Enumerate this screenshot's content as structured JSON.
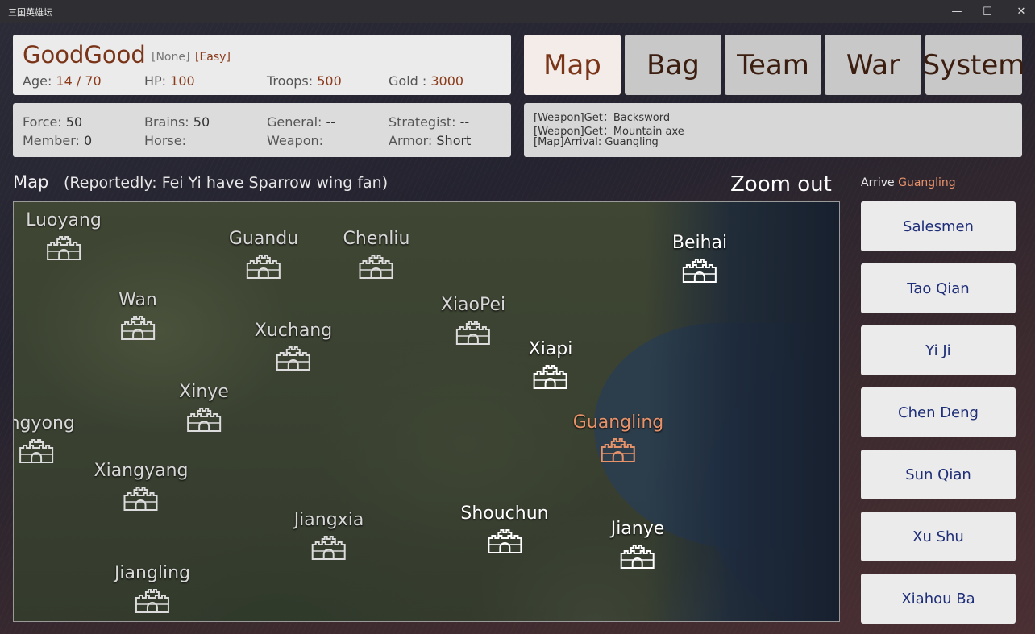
{
  "window": {
    "title": "三国英雄坛",
    "minimize": "—",
    "maximize": "☐",
    "close": "✕"
  },
  "player": {
    "name": "GoodGood",
    "faction": "[None]",
    "difficulty": "[Easy]",
    "age_label": "Age: ",
    "age_value": "14 / 70",
    "hp_label": "HP: ",
    "hp_value": "100",
    "troops_label": "Troops: ",
    "troops_value": "500",
    "gold_label": "Gold : ",
    "gold_value": "3000"
  },
  "stats": {
    "force_label": "Force: ",
    "force_value": "50",
    "brains_label": "Brains: ",
    "brains_value": "50",
    "general_label": "General: ",
    "general_value": "--",
    "strategist_label": "Strategist: ",
    "strategist_value": "--",
    "member_label": "Member: ",
    "member_value": "0",
    "horse_label": "Horse: ",
    "horse_value": "",
    "weapon_label": "Weapon: ",
    "weapon_value": "",
    "armor_label": "Armor: ",
    "armor_value": "Short"
  },
  "tabs": [
    {
      "label": "Map",
      "active": true
    },
    {
      "label": "Bag",
      "active": false
    },
    {
      "label": "Team",
      "active": false
    },
    {
      "label": "War",
      "active": false
    },
    {
      "label": "System",
      "active": false
    }
  ],
  "log": [
    "[Weapon]Get：Backsword",
    "[Weapon]Get：Mountain axe",
    "[Map]Arrival: Guangling"
  ],
  "map": {
    "heading": "Map",
    "rumor": "(Reportedly: Fei Yi have Sparrow wing fan)",
    "zoom_label": "Zoom out",
    "cities": [
      {
        "name": "Luoyang",
        "style": "normal"
      },
      {
        "name": "Guandu",
        "style": "normal"
      },
      {
        "name": "Chenliu",
        "style": "normal"
      },
      {
        "name": "Beihai",
        "style": "bright"
      },
      {
        "name": "Wan",
        "style": "normal"
      },
      {
        "name": "XiaoPei",
        "style": "normal"
      },
      {
        "name": "Xuchang",
        "style": "normal"
      },
      {
        "name": "Xiapi",
        "style": "bright"
      },
      {
        "name": "Xinye",
        "style": "normal"
      },
      {
        "name": "angyong",
        "style": "normal"
      },
      {
        "name": "Guangling",
        "style": "current"
      },
      {
        "name": "Xiangyang",
        "style": "normal"
      },
      {
        "name": "Shouchun",
        "style": "bright"
      },
      {
        "name": "Jiangxia",
        "style": "normal"
      },
      {
        "name": "Jianye",
        "style": "bright"
      },
      {
        "name": "Jiangling",
        "style": "normal"
      }
    ]
  },
  "location": {
    "arrive_label": "Arrive ",
    "place": "Guangling",
    "people": [
      "Salesmen",
      "Tao Qian",
      "Yi Ji",
      "Chen Deng",
      "Sun Qian",
      "Xu Shu",
      "Xiahou Ba"
    ]
  },
  "colors": {
    "accent": "#7a3418",
    "current_city": "#e8926a",
    "npc_text": "#1e2e78"
  }
}
